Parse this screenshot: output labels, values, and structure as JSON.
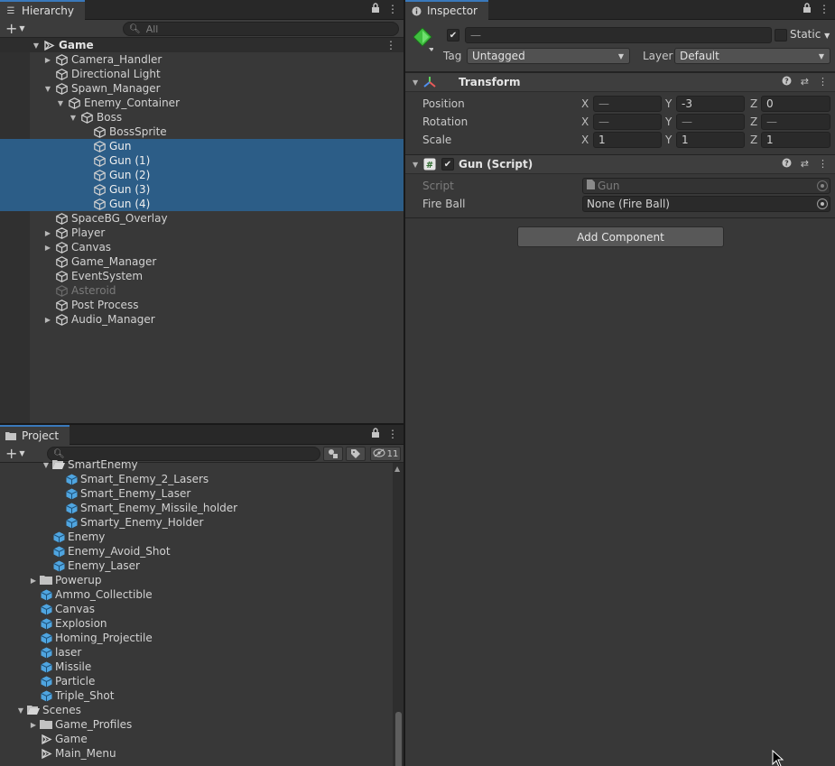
{
  "hierarchy": {
    "tab_label": "Hierarchy",
    "search_placeholder": "All",
    "rows": [
      {
        "label": "Game",
        "depth": 0,
        "expanded": true,
        "kind": "scene"
      },
      {
        "label": "Camera_Handler",
        "depth": 1,
        "expanded": false,
        "kind": "object"
      },
      {
        "label": "Directional Light",
        "depth": 1,
        "kind": "object"
      },
      {
        "label": "Spawn_Manager",
        "depth": 1,
        "expanded": true,
        "kind": "object"
      },
      {
        "label": "Enemy_Container",
        "depth": 2,
        "expanded": true,
        "kind": "object"
      },
      {
        "label": "Boss",
        "depth": 3,
        "expanded": true,
        "kind": "object"
      },
      {
        "label": "BossSprite",
        "depth": 4,
        "kind": "object"
      },
      {
        "label": "Gun",
        "depth": 4,
        "kind": "object",
        "selected": true
      },
      {
        "label": "Gun (1)",
        "depth": 4,
        "kind": "object",
        "selected": true
      },
      {
        "label": "Gun (2)",
        "depth": 4,
        "kind": "object",
        "selected": true
      },
      {
        "label": "Gun (3)",
        "depth": 4,
        "kind": "object",
        "selected": true
      },
      {
        "label": "Gun (4)",
        "depth": 4,
        "kind": "object",
        "selected": true
      },
      {
        "label": "SpaceBG_Overlay",
        "depth": 1,
        "kind": "object"
      },
      {
        "label": "Player",
        "depth": 1,
        "expanded": false,
        "kind": "object"
      },
      {
        "label": "Canvas",
        "depth": 1,
        "expanded": false,
        "kind": "object"
      },
      {
        "label": "Game_Manager",
        "depth": 1,
        "kind": "object"
      },
      {
        "label": "EventSystem",
        "depth": 1,
        "kind": "object"
      },
      {
        "label": "Asteroid",
        "depth": 1,
        "kind": "object",
        "inactive": true
      },
      {
        "label": "Post Process",
        "depth": 1,
        "kind": "object"
      },
      {
        "label": "Audio_Manager",
        "depth": 1,
        "expanded": false,
        "kind": "object"
      }
    ]
  },
  "project": {
    "tab_label": "Project",
    "hidden_count": "11",
    "rows": [
      {
        "label": "SmartEnemy",
        "depth": 2,
        "expanded": true,
        "kind": "folder-open"
      },
      {
        "label": "Smart_Enemy_2_Lasers",
        "depth": 3,
        "kind": "prefab"
      },
      {
        "label": "Smart_Enemy_Laser",
        "depth": 3,
        "kind": "prefab"
      },
      {
        "label": "Smart_Enemy_Missile_holder",
        "depth": 3,
        "kind": "prefab"
      },
      {
        "label": "Smarty_Enemy_Holder",
        "depth": 3,
        "kind": "prefab"
      },
      {
        "label": "Enemy",
        "depth": 2,
        "kind": "prefab"
      },
      {
        "label": "Enemy_Avoid_Shot",
        "depth": 2,
        "kind": "prefab"
      },
      {
        "label": "Enemy_Laser",
        "depth": 2,
        "kind": "prefab"
      },
      {
        "label": "Powerup",
        "depth": 1,
        "expanded": false,
        "kind": "folder"
      },
      {
        "label": "Ammo_Collectible",
        "depth": 1,
        "kind": "prefab"
      },
      {
        "label": "Canvas",
        "depth": 1,
        "kind": "prefab"
      },
      {
        "label": "Explosion",
        "depth": 1,
        "kind": "prefab"
      },
      {
        "label": "Homing_Projectile",
        "depth": 1,
        "kind": "prefab"
      },
      {
        "label": "laser",
        "depth": 1,
        "kind": "prefab"
      },
      {
        "label": "Missile",
        "depth": 1,
        "kind": "prefab"
      },
      {
        "label": "Particle",
        "depth": 1,
        "kind": "prefab"
      },
      {
        "label": "Triple_Shot",
        "depth": 1,
        "kind": "prefab"
      },
      {
        "label": "Scenes",
        "depth": 0,
        "expanded": true,
        "kind": "folder-open"
      },
      {
        "label": "Game_Profiles",
        "depth": 1,
        "expanded": false,
        "kind": "folder"
      },
      {
        "label": "Game",
        "depth": 1,
        "kind": "unity-scene"
      },
      {
        "label": "Main_Menu",
        "depth": 1,
        "kind": "unity-scene"
      }
    ]
  },
  "inspector": {
    "tab_label": "Inspector",
    "object_name": "—",
    "static_label": "Static",
    "tag_label": "Tag",
    "tag_value": "Untagged",
    "layer_label": "Layer",
    "layer_value": "Default",
    "transform": {
      "title": "Transform",
      "position_label": "Position",
      "rotation_label": "Rotation",
      "scale_label": "Scale",
      "axis_x": "X",
      "axis_y": "Y",
      "axis_z": "Z",
      "position": [
        "—",
        "-3",
        "0"
      ],
      "rotation": [
        "—",
        "—",
        "—"
      ],
      "scale": [
        "1",
        "1",
        "1"
      ]
    },
    "gun_script": {
      "title": "Gun (Script)",
      "script_label": "Script",
      "script_value": "Gun",
      "fireball_label": "Fire Ball",
      "fireball_value": "None (Fire Ball)"
    },
    "add_component_label": "Add Component"
  },
  "colors": {
    "selection": "#2c5d87",
    "accent_tab": "#3a79bb",
    "prefab_blue": "#4fa5e0"
  }
}
